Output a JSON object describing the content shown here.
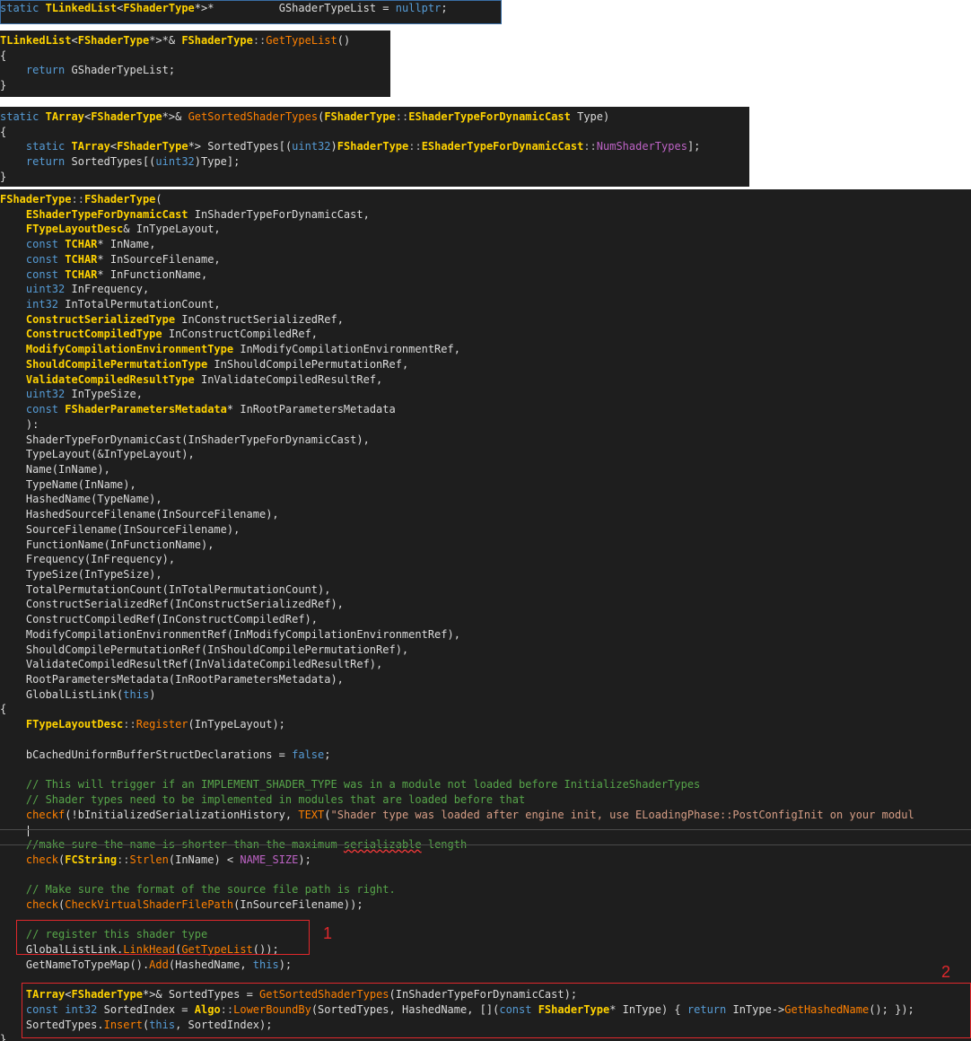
{
  "snippet1": {
    "lines": [
      "static TLinkedList<FShaderType*>*          GShaderTypeList = nullptr;"
    ]
  },
  "snippet2": {
    "lines": [
      "TLinkedList<FShaderType*>*& FShaderType::GetTypeList()",
      "{",
      "    return GShaderTypeList;",
      "}"
    ]
  },
  "snippet3": {
    "lines": [
      "static TArray<FShaderType*>& GetSortedShaderTypes(FShaderType::EShaderTypeForDynamicCast Type)",
      "{",
      "    static TArray<FShaderType*> SortedTypes[(uint32)FShaderType::EShaderTypeForDynamicCast::NumShaderTypes];",
      "    return SortedTypes[(uint32)Type];",
      "}"
    ]
  },
  "snippet4": {
    "lines": [
      "FShaderType::FShaderType(",
      "    EShaderTypeForDynamicCast InShaderTypeForDynamicCast,",
      "    FTypeLayoutDesc& InTypeLayout,",
      "    const TCHAR* InName,",
      "    const TCHAR* InSourceFilename,",
      "    const TCHAR* InFunctionName,",
      "    uint32 InFrequency,",
      "    int32 InTotalPermutationCount,",
      "    ConstructSerializedType InConstructSerializedRef,",
      "    ConstructCompiledType InConstructCompiledRef,",
      "    ModifyCompilationEnvironmentType InModifyCompilationEnvironmentRef,",
      "    ShouldCompilePermutationType InShouldCompilePermutationRef,",
      "    ValidateCompiledResultType InValidateCompiledResultRef,",
      "    uint32 InTypeSize,",
      "    const FShaderParametersMetadata* InRootParametersMetadata",
      "    ):",
      "    ShaderTypeForDynamicCast(InShaderTypeForDynamicCast),",
      "    TypeLayout(&InTypeLayout),",
      "    Name(InName),",
      "    TypeName(InName),",
      "    HashedName(TypeName),",
      "    HashedSourceFilename(InSourceFilename),",
      "    SourceFilename(InSourceFilename),",
      "    FunctionName(InFunctionName),",
      "    Frequency(InFrequency),",
      "    TypeSize(InTypeSize),",
      "    TotalPermutationCount(InTotalPermutationCount),",
      "    ConstructSerializedRef(InConstructSerializedRef),",
      "    ConstructCompiledRef(InConstructCompiledRef),",
      "    ModifyCompilationEnvironmentRef(InModifyCompilationEnvironmentRef),",
      "    ShouldCompilePermutationRef(InShouldCompilePermutationRef),",
      "    ValidateCompiledResultRef(InValidateCompiledResultRef),",
      "    RootParametersMetadata(InRootParametersMetadata),",
      "    GlobalListLink(this)",
      "{",
      "    FTypeLayoutDesc::Register(InTypeLayout);",
      "",
      "    bCachedUniformBufferStructDeclarations = false;",
      "",
      "    // This will trigger if an IMPLEMENT_SHADER_TYPE was in a module not loaded before InitializeShaderTypes",
      "    // Shader types need to be implemented in modules that are loaded before that",
      "    checkf(!bInitializedSerializationHistory, TEXT(\"Shader type was loaded after engine init, use ELoadingPhase::PostConfigInit on your modul",
      "",
      "    //make sure the name is shorter than the maximum serializable length",
      "    check(FCString::Strlen(InName) < NAME_SIZE);",
      "",
      "    // Make sure the format of the source file path is right.",
      "    check(CheckVirtualShaderFilePath(InSourceFilename));",
      "",
      "    // register this shader type",
      "    GlobalListLink.LinkHead(GetTypeList());",
      "    GetNameToTypeMap().Add(HashedName, this);",
      "",
      "    TArray<FShaderType*>& SortedTypes = GetSortedShaderTypes(InShaderTypeForDynamicCast);",
      "    const int32 SortedIndex = Algo::LowerBoundBy(SortedTypes, HashedName, [](const FShaderType* InType) { return InType->GetHashedName(); });",
      "    SortedTypes.Insert(this, SortedIndex);",
      "}"
    ]
  },
  "annotations": {
    "box1_label": "1",
    "box2_label": "2"
  },
  "colors": {
    "editor_background": "#1e1e1e",
    "keyword": "#569cd6",
    "type": "#ffd200",
    "function": "#ff8000",
    "comment": "#57a64a",
    "string": "#d69d85",
    "annotation_red": "#e0282c"
  }
}
